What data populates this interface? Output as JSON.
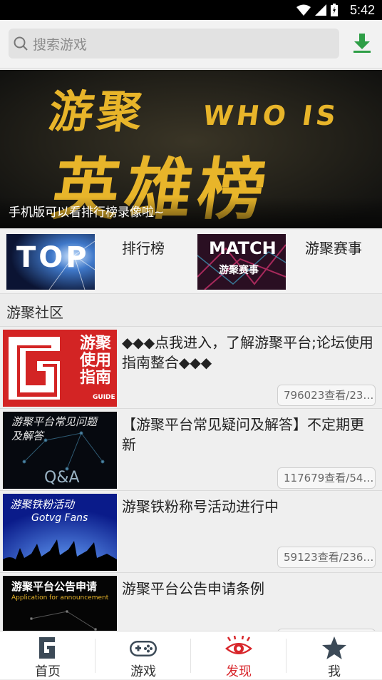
{
  "status_bar": {
    "time": "5:42"
  },
  "search": {
    "placeholder": "搜索游戏"
  },
  "banner": {
    "title_top": "游聚",
    "who_is": "WHO IS",
    "title_main": "英雄榜",
    "caption": "手机版可以看排行榜录像啦~"
  },
  "quick_links": [
    {
      "thumb_text": "TOP",
      "label": "排行榜"
    },
    {
      "thumb_text": "MATCH",
      "thumb_sub": "游聚赛事",
      "label": "游聚赛事"
    }
  ],
  "section": {
    "title": "游聚社区"
  },
  "posts": [
    {
      "thumb_lines": [
        "游聚",
        "使用",
        "指南"
      ],
      "thumb_sub": "GUIDE",
      "title": "◆◆◆点我进入，了解游聚平台;论坛使用指南整合◆◆◆",
      "stat": "796023查看/23…"
    },
    {
      "thumb_lines": [
        "游聚平台常见问题",
        "及解答"
      ],
      "thumb_sub": "Q&A",
      "title": "【游聚平台常见疑问及解答】不定期更新",
      "stat": "117679查看/54…"
    },
    {
      "thumb_lines": [
        "游聚铁粉活动"
      ],
      "thumb_sub": "Gotvg Fans",
      "title": "游聚铁粉称号活动进行中",
      "stat": "59123查看/236…"
    },
    {
      "thumb_lines": [
        "游聚平台公告申请"
      ],
      "thumb_sub": "Application for announcement",
      "title": "游聚平台公告申请条例",
      "stat": ""
    }
  ],
  "tabs": [
    {
      "label": "首页",
      "icon": "home-logo-icon"
    },
    {
      "label": "游戏",
      "icon": "gamepad-icon"
    },
    {
      "label": "发现",
      "icon": "eye-icon",
      "active": true
    },
    {
      "label": "我",
      "icon": "star-icon"
    }
  ],
  "colors": {
    "accent": "#d8262b",
    "download": "#2e9e46",
    "banner_gold": "#e8b52a"
  }
}
